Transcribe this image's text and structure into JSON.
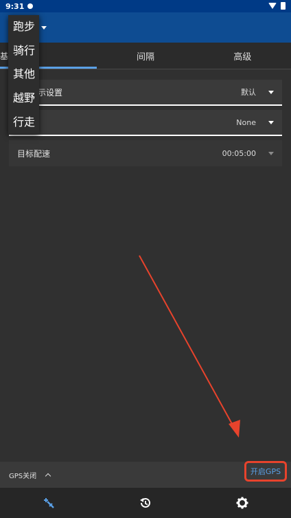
{
  "status_bar": {
    "time": "9:31"
  },
  "activity_menu": {
    "items": [
      "跑步",
      "骑行",
      "其他",
      "越野",
      "行走"
    ]
  },
  "tabs": [
    {
      "label": "基"
    },
    {
      "label": "间隔"
    },
    {
      "label": "高级"
    }
  ],
  "settings": {
    "rows": [
      {
        "label": "示设置",
        "value": "默认"
      },
      {
        "label": "",
        "value": "None"
      },
      {
        "label": "目标配速",
        "value": "00:05:00"
      }
    ]
  },
  "gps_bar": {
    "status": "GPS关闭",
    "enable_button": "开启GPS"
  },
  "bottom_nav": {
    "items": [
      "workout-icon",
      "history-icon",
      "settings-icon"
    ],
    "active_color": "#5aa0e6"
  },
  "colors": {
    "app_bar": "#0e4c92",
    "status_bar": "#003a86",
    "accent": "#5aa0e6",
    "annotation": "#e8432c"
  }
}
